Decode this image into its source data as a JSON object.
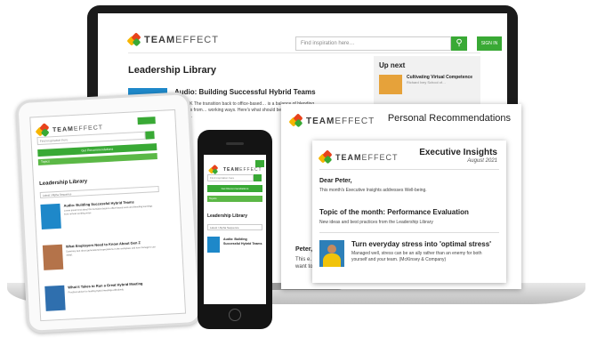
{
  "brand": {
    "logo_bold": "TEAM",
    "logo_light": "EFFECT"
  },
  "laptop": {
    "search_placeholder": "Find inspiration here…",
    "signin_label": "SIGN IN",
    "page_title": "Leadership Library",
    "article_title": "Audio: Building Successful Hybrid Teams",
    "article_body": "…WORK The transition back to office-based… is a balance of blending learnings from… working ways. Here's what should be… Harvard Business School…",
    "upnext_title": "Up next",
    "upnext_item_title": "Cultivating Virtual Competence",
    "upnext_item_source": "Richard Ivey School of…"
  },
  "email_recommendations": {
    "header": "Personal Recommendations",
    "greeting": "Peter,",
    "body_snippet": "This e… want to…"
  },
  "email_insights": {
    "header": "Executive Insights",
    "date": "August 2021",
    "greeting": "Dear Peter,",
    "intro": "This month's Executive Insights addresses Well-being.",
    "topic_title": "Topic of the month: Performance Evaluation",
    "topic_body": "New ideas and best practices from the Leadership Library",
    "article_title": "Turn everyday stress into 'optimal stress'",
    "article_body": "Managed well, stress can be an ally rather than an enemy for both yourself and your team. (McKinsey & Company)"
  },
  "tablet": {
    "search_placeholder": "Find inspiration here",
    "bar_label": "Get Recommendations",
    "filter_label": "Topics",
    "library_title": "Leadership Library",
    "select_label": "Latest / Alpha Sequence",
    "items": [
      {
        "title": "Audio: Building Successful Hybrid Teams",
        "body": "Lorem ipsum text about the transition back to office-based work and blending learnings from remote working ways.",
        "thumb": "#1e88c9"
      },
      {
        "title": "What Employers Need to Know About Gen Z",
        "body": "Summary text about generational expectations in the workplace and how managers can adapt.",
        "thumb": "#b4734a"
      },
      {
        "title": "What it Takes to Run a Great Hybrid Meeting",
        "body": "Practical advice for leading hybrid meetings effectively.",
        "thumb": "#2f6fae"
      }
    ]
  },
  "phone": {
    "search_placeholder": "Find inspiration here",
    "bar_label": "Get Recommendations",
    "filter_label": "Topics",
    "library_title": "Leadership Library",
    "select_label": "Latest / Alpha Sequence",
    "item_title": "Audio: Building Successful Hybrid Teams"
  }
}
